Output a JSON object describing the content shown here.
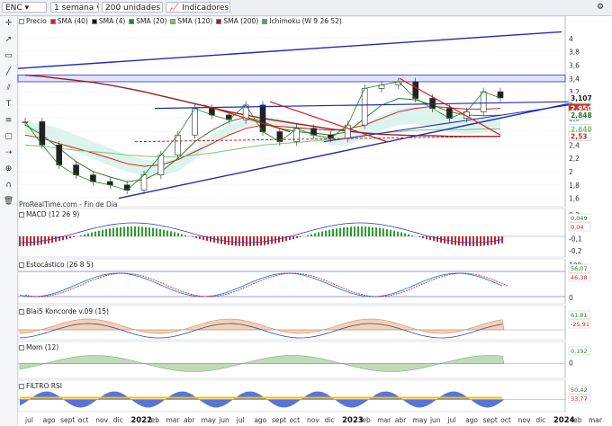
{
  "toolbar": {
    "symbol": "ENC",
    "period": "1 semana",
    "units": "200 unidades",
    "indicators": "Indicadores"
  },
  "main_legend": [
    {
      "label": "Precio",
      "color": "#ffffff"
    },
    {
      "label": "SMA (40)",
      "color": "#cc2222"
    },
    {
      "label": "SMA (4)",
      "color": "#111111"
    },
    {
      "label": "SMA (20)",
      "color": "#2e7d32"
    },
    {
      "label": "SMA (120)",
      "color": "#7cc47c"
    },
    {
      "label": "SMA (200)",
      "color": "#9e1b1b"
    },
    {
      "label": "Ichimoku (W 9 26 52)",
      "color": "#4caf50"
    }
  ],
  "credit": "ProRealTime.com - Fin de Día",
  "price_tags": [
    {
      "text": "3,107",
      "color": "#ffffff",
      "text_color": "#222222",
      "value": 3.107
    },
    {
      "text": "2,950",
      "color": "#c0392b",
      "text_color": "#ffffff",
      "value": 2.95
    },
    {
      "text": "2,848",
      "color": "#ffffff",
      "text_color": "#2e7d32",
      "value": 2.848
    },
    {
      "text": "2,640",
      "color": "#ffffff",
      "text_color": "#7cc47c",
      "value": 2.64
    },
    {
      "text": "2,53",
      "color": "#ffffff",
      "text_color": "#c0392b",
      "value": 2.53
    }
  ],
  "panels": {
    "macd": {
      "label": "MACD (12 26 9)",
      "ticks": [
        "0,2",
        "0",
        "-0,1",
        "-0,2"
      ],
      "tags": [
        "0,049",
        "0,04"
      ]
    },
    "stoch": {
      "label": "Estocástico (26 8 5)",
      "ticks": [
        "100",
        "0"
      ],
      "tags": [
        "56,07",
        "46,38"
      ]
    },
    "blai5": {
      "label": "Blai5 Koncorde v.09 (15)",
      "ticks": [
        "0"
      ],
      "tags": [
        "61,81",
        "-25,91"
      ]
    },
    "mom": {
      "label": "Mom (12)",
      "ticks": [
        "0"
      ],
      "tags": [
        "0,192"
      ]
    },
    "rsi": {
      "label": "FILTRO RSI",
      "ticks": [
        "0"
      ],
      "tags": [
        "50,42",
        "33,77"
      ]
    }
  },
  "x_axis_labels": [
    "jul",
    "ago",
    "sept",
    "oct",
    "nov",
    "dic",
    "2022",
    "feb",
    "mar",
    "abr",
    "may",
    "jun",
    "jul",
    "ago",
    "sept",
    "oct",
    "nov",
    "dic",
    "2023",
    "feb",
    "mar",
    "abr",
    "may",
    "jun",
    "jul",
    "ago",
    "sept",
    "oct",
    "nov",
    "dic",
    "2024",
    "feb",
    "mar"
  ],
  "chart_data": {
    "type": "line",
    "title": "ENC",
    "ylim": [
      1.5,
      4.2
    ],
    "y_ticks": [
      1.6,
      1.8,
      2.0,
      2.2,
      2.4,
      2.6,
      2.8,
      3.0,
      3.2,
      3.4,
      3.6,
      3.8,
      4.0
    ],
    "y_tick_labels": [
      "1,6",
      "1,8",
      "2",
      "2,2",
      "2,4",
      "2,6",
      "2,8",
      "3",
      "3,2",
      "3,4",
      "3,6",
      "3,8",
      "4"
    ],
    "x": [
      "2021-06",
      "2021-07",
      "2021-08",
      "2021-09",
      "2021-10",
      "2021-11",
      "2021-12",
      "2022-01",
      "2022-02",
      "2022-03",
      "2022-04",
      "2022-05",
      "2022-06",
      "2022-07",
      "2022-08",
      "2022-09",
      "2022-10",
      "2022-11",
      "2022-12",
      "2023-01",
      "2023-02",
      "2023-03",
      "2023-04",
      "2023-05",
      "2023-06",
      "2023-07",
      "2023-08",
      "2023-09",
      "2023-10"
    ],
    "series": [
      {
        "name": "Precio",
        "values": [
          2.75,
          2.4,
          2.1,
          1.95,
          1.85,
          1.8,
          1.72,
          1.95,
          2.25,
          2.55,
          2.95,
          2.85,
          2.78,
          3.0,
          2.6,
          2.45,
          2.65,
          2.55,
          2.5,
          2.7,
          3.25,
          3.3,
          3.35,
          3.1,
          2.95,
          2.8,
          2.9,
          3.2,
          3.107
        ]
      },
      {
        "name": "SMA (40)",
        "values": [
          2.55,
          2.5,
          2.42,
          2.35,
          2.28,
          2.2,
          2.12,
          2.08,
          2.1,
          2.18,
          2.3,
          2.42,
          2.55,
          2.65,
          2.7,
          2.68,
          2.66,
          2.64,
          2.62,
          2.64,
          2.7,
          2.8,
          2.9,
          2.95,
          2.98,
          2.96,
          2.94,
          2.94,
          2.95
        ]
      },
      {
        "name": "SMA (20)",
        "values": [
          2.7,
          2.55,
          2.35,
          2.15,
          2.0,
          1.92,
          1.85,
          1.88,
          2.0,
          2.2,
          2.45,
          2.62,
          2.75,
          2.82,
          2.75,
          2.65,
          2.6,
          2.58,
          2.55,
          2.6,
          2.8,
          3.0,
          3.1,
          3.08,
          3.0,
          2.9,
          2.85,
          2.84,
          2.848
        ]
      },
      {
        "name": "SMA (120)",
        "values": [
          2.4,
          2.38,
          2.35,
          2.32,
          2.3,
          2.28,
          2.25,
          2.23,
          2.22,
          2.22,
          2.25,
          2.28,
          2.32,
          2.36,
          2.4,
          2.42,
          2.44,
          2.46,
          2.48,
          2.5,
          2.54,
          2.58,
          2.6,
          2.62,
          2.63,
          2.63,
          2.63,
          2.64,
          2.64
        ]
      },
      {
        "name": "SMA (200)",
        "values": [
          3.45,
          3.43,
          3.4,
          3.37,
          3.34,
          3.3,
          3.25,
          3.2,
          3.14,
          3.08,
          3.02,
          2.96,
          2.9,
          2.85,
          2.8,
          2.76,
          2.72,
          2.68,
          2.64,
          2.61,
          2.58,
          2.56,
          2.55,
          2.54,
          2.54,
          2.53,
          2.53,
          2.53,
          2.53
        ]
      }
    ]
  }
}
